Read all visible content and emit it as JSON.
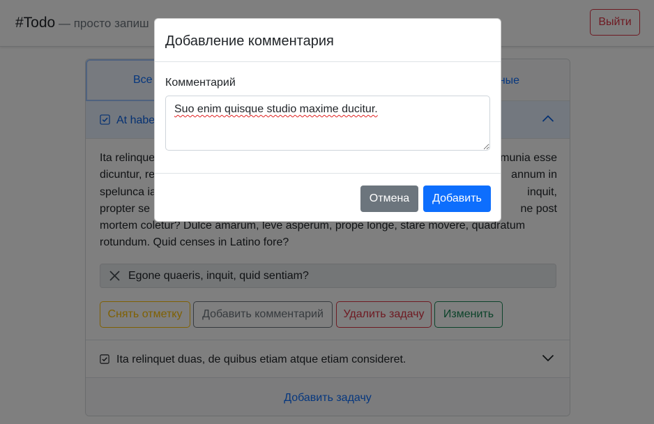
{
  "navbar": {
    "brand": "#Todo",
    "tagline": "— просто запиш",
    "logout_label": "Выйти"
  },
  "tabs": {
    "first_label": "Все з",
    "last_label": "нные"
  },
  "task_1": {
    "title": "At habe",
    "body": "Ita relinque                                                                        munia esse dicuntur, re                                                                    annum in spelunca ia                                                                        inquit, propter se                                                                          ne post mortem coletur? Dulce amarum, leve asperum, prope longe, stare movere, quadratum rotundum. Quid censes in Latino fore?",
    "body_lines": [
      "Ita relinque",
      "munia esse",
      "dicuntur, re",
      "annum in",
      "spelunca ia",
      "inquit,",
      "propter se",
      "ne post",
      "mortem coletur? Dulce amarum, leve asperum, prope longe, stare movere, quadratum",
      "rotundum. Quid censes in Latino fore?"
    ],
    "comment": "Egone quaeris, inquit, quid sentiam?",
    "actions": {
      "uncheck": "Снять отметку",
      "add_comment": "Добавить комментарий",
      "delete": "Удалить задачу",
      "edit": "Изменить"
    }
  },
  "task_2": {
    "title": "Ita relinquet duas, de quibus etiam atque etiam consideret."
  },
  "add_task_label": "Добавить задачу",
  "modal": {
    "title": "Добавление комментария",
    "field_label": "Комментарий",
    "comment_value": "Suo enim quisque studio maxime ducitur.",
    "cancel_label": "Отмена",
    "submit_label": "Добавить"
  },
  "colors": {
    "primary": "#0d6efd",
    "secondary": "#6c757d",
    "danger": "#dc3545",
    "warning": "#ffc107",
    "success": "#198754"
  },
  "icons": [
    "check-square-icon",
    "chevron-up-icon",
    "chevron-down-icon",
    "x-icon",
    "resize-grip-icon"
  ]
}
